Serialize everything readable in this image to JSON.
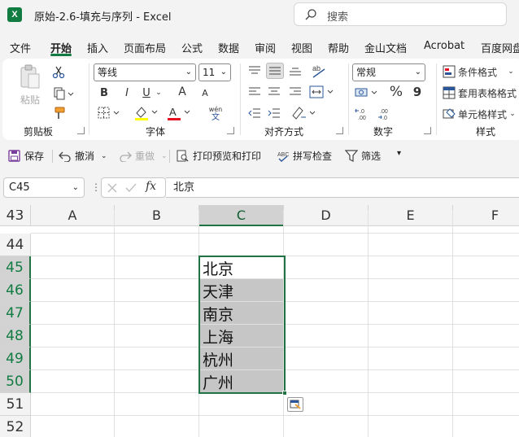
{
  "window": {
    "title": "原始-2.6-填充与序列 - Excel",
    "logo": "X"
  },
  "search": {
    "label": "搜索"
  },
  "menu": {
    "items": [
      "文件",
      "开始",
      "插入",
      "页面布局",
      "公式",
      "数据",
      "审阅",
      "视图",
      "帮助",
      "金山文档",
      "Acrobat",
      "百度网盘"
    ],
    "active": "开始"
  },
  "ribbon": {
    "clipboard": {
      "label": "剪贴板",
      "paste": "粘贴"
    },
    "font": {
      "label": "字体",
      "name": "等线",
      "size": "11",
      "bold": "B",
      "italic": "I",
      "underline": "U",
      "grow": "A",
      "shrink": "A",
      "wen_top": "wén",
      "wen_bottom": "文"
    },
    "align": {
      "label": "对齐方式"
    },
    "number": {
      "label": "数字",
      "format": "常规",
      "percent": "%",
      "comma": "9",
      "inc_decimal": "←.0\n.00",
      "dec_decimal": ".00\n→.0"
    },
    "styles": {
      "label": "样式",
      "conditional": "条件格式",
      "table": "套用表格格式",
      "cell": "单元格样式"
    }
  },
  "qat": {
    "save": "保存",
    "undo": "撤消",
    "redo": "重做",
    "print": "打印预览和打印",
    "spell": "拼写检查",
    "filter": "筛选"
  },
  "formula_bar": {
    "name_box": "C45",
    "fx": "fx",
    "value": "北京"
  },
  "sheet": {
    "columns": [
      "A",
      "B",
      "C",
      "D",
      "E",
      "F"
    ],
    "selected_column": "C",
    "rows": [
      "43",
      "44",
      "45",
      "46",
      "47",
      "48",
      "49",
      "50",
      "51",
      "52"
    ],
    "selected_rows": [
      "45",
      "46",
      "47",
      "48",
      "49",
      "50"
    ],
    "cells": {
      "C45": "北京",
      "C46": "天津",
      "C47": "南京",
      "C48": "上海",
      "C49": "杭州",
      "C50": "广州"
    }
  },
  "colors": {
    "accent": "#107c41",
    "selection_border": "#217346",
    "fill_selected": "#c6c6c6"
  }
}
